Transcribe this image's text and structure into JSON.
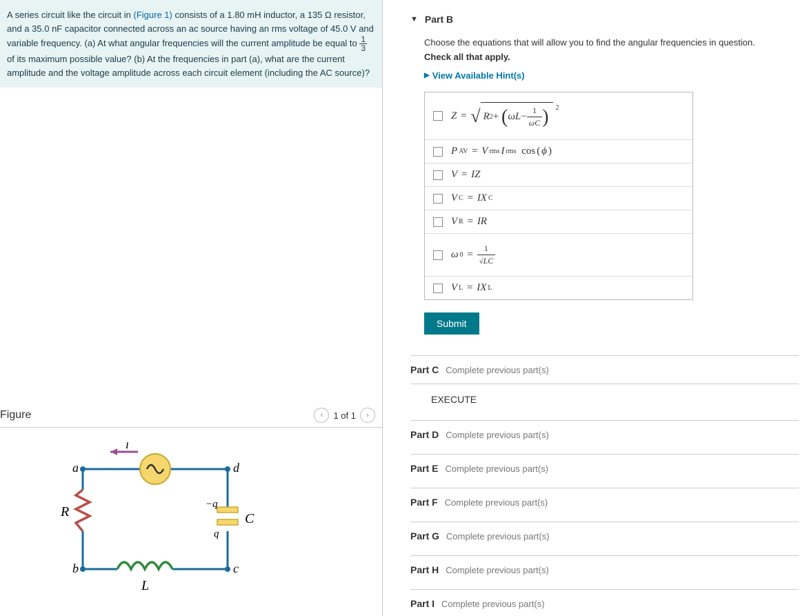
{
  "problem": {
    "text_pre": "A series circuit like the circuit in ",
    "figure_link": "(Figure 1)",
    "text_mid1": " consists of a 1.80 ",
    "unit1": "mH",
    "text_mid2": " inductor, a 135 ",
    "unit2": "Ω",
    "text_mid3": " resistor, and a 35.0 ",
    "unit3": "nF",
    "text_mid4": " capacitor connected across an ac source having an rms voltage of 45.0 ",
    "unit4": "V",
    "text_mid5": " and variable frequency. (a) At what angular frequencies will the current amplitude be equal to ",
    "frac_num": "1",
    "frac_den": "3",
    "text_end": " of its maximum possible value? (b) At the frequencies in part (a), what are the current amplitude and the voltage amplitude across each circuit element (including the AC source)?"
  },
  "figure": {
    "title": "Figure",
    "pager": "1 of 1",
    "labels": {
      "a": "a",
      "b": "b",
      "c": "c",
      "d": "d",
      "R": "R",
      "C": "C",
      "L": "L",
      "i": "i",
      "minus_q": "−q",
      "q": "q"
    }
  },
  "partB": {
    "title": "Part B",
    "instruction": "Choose the equations that will allow you to find the angular frequencies in question.",
    "check_all": "Check all that apply.",
    "hint": "View Available Hint(s)",
    "submit": "Submit"
  },
  "equations": {
    "eq1_lhs": "Z",
    "eq1_R2": "R",
    "eq1_wL": "ωL",
    "eq1_wC": "ωC",
    "eq2_lhs": "P",
    "eq2_av": "AV",
    "eq2_rhs1": "V",
    "eq2_rms": "rms",
    "eq2_rhs2": "I",
    "eq2_cos": "cos",
    "eq2_phi": "ϕ",
    "eq3_lhs": "V",
    "eq3_rhs": "IZ",
    "eq4_lhs": "V",
    "eq4_c": "C",
    "eq4_rhs": "IX",
    "eq5_lhs": "V",
    "eq5_r": "R",
    "eq5_rhs": "IR",
    "eq6_lhs": "ω",
    "eq6_0": "0",
    "eq6_num": "1",
    "eq6_den": "LC",
    "eq7_lhs": "V",
    "eq7_l": "L",
    "eq7_rhs": "IX"
  },
  "subparts": {
    "c_label": "Part C",
    "c_msg": "Complete previous part(s)",
    "execute": "EXECUTE",
    "d_label": "Part D",
    "d_msg": "Complete previous part(s)",
    "e_label": "Part E",
    "e_msg": "Complete previous part(s)",
    "f_label": "Part F",
    "f_msg": "Complete previous part(s)",
    "g_label": "Part G",
    "g_msg": "Complete previous part(s)",
    "h_label": "Part H",
    "h_msg": "Complete previous part(s)",
    "i_label": "Part I",
    "i_msg": "Complete previous part(s)"
  }
}
